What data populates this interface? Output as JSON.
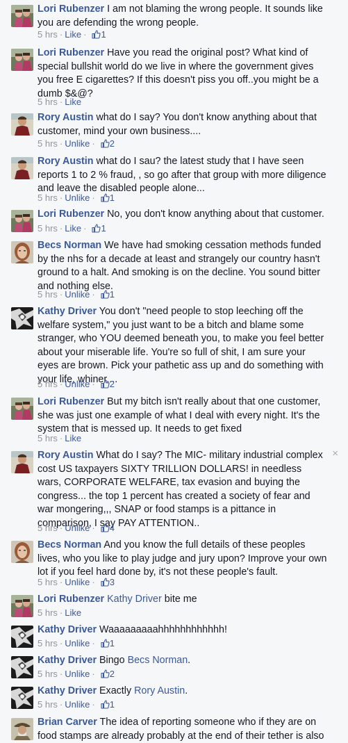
{
  "comments": [
    {
      "author": "Lori Rubenzer",
      "avatar": "lori-avatar",
      "segments": [
        {
          "text": "I am not blaming the wrong people. It sounds like you are defending the wrong people."
        }
      ],
      "time": "5 hrs",
      "action": "Like",
      "likes": "1"
    },
    {
      "author": "Lori Rubenzer",
      "avatar": "lori-avatar",
      "segments": [
        {
          "text": "Have you read the original post? What kind of special bullshit world do we live in where the government gives you free E cigarettes? If this doesn't piss you off..you might be a dumb $&@?"
        }
      ],
      "time": "5 hrs",
      "action": "Like",
      "likes": ""
    },
    {
      "author": "Rory Austin",
      "avatar": "rory-avatar",
      "segments": [
        {
          "text": "what do I say? You don't know anything about that customer, mind your own business...."
        }
      ],
      "time": "5 hrs",
      "action": "Unlike",
      "likes": "2"
    },
    {
      "author": "Rory Austin",
      "avatar": "rory-avatar",
      "segments": [
        {
          "text": "what do I sau? the latest study that I have seen reports 1 to 2 % fraud, , so go after that group with more diligence and leave the disabled people alone..."
        }
      ],
      "time": "5 hrs",
      "action": "Unlike",
      "likes": "1"
    },
    {
      "author": "Lori Rubenzer",
      "avatar": "lori-avatar",
      "segments": [
        {
          "text": "No, you don't know anything about that customer."
        }
      ],
      "time": "5 hrs",
      "action": "Like",
      "likes": "1"
    },
    {
      "author": "Becs Norman",
      "avatar": "becs-avatar",
      "segments": [
        {
          "text": "We have had smoking cessation methods funded by the nhs for a decade at least and strangely our country hasn't ground to a halt. And smoking is on the decline. You sound bitter and nothing else."
        }
      ],
      "time": "5 hrs",
      "action": "Unlike",
      "likes": "1"
    },
    {
      "author": "Kathy Driver",
      "avatar": "kathy-avatar",
      "segments": [
        {
          "text": "You don't \"need people to stop leeching off the welfare system,\" you just want to be a bitch and blame some stranger, who YOU deemed beneath you, to make you feel better about your miserable life. You're so full of shit, I am sure your eyes are brown. Pick your pathetic ass up and do something with your life, whiner...."
        }
      ],
      "time": "5 hrs",
      "action": "Unlike",
      "likes": "2"
    },
    {
      "author": "Lori Rubenzer",
      "avatar": "lori-avatar",
      "segments": [
        {
          "text": "But my bitch isn't really about that one customer, she was just one example of what I deal with every night. It's the system that is messed up. It needs to get fixed"
        }
      ],
      "time": "5 hrs",
      "action": "Like",
      "likes": ""
    },
    {
      "author": "Rory Austin",
      "avatar": "rory-avatar",
      "segments": [
        {
          "text": "What do I say? The MIC- military industrial complex cost US taxpayers SIXTY TRILLION DOLLARS! in needless wars, CORPORATE WELFARE, tax evasion and buying the congress... the top 1 percent has created a society of fear and war mongering,,, SNAP or food stamps is a pittance in comparison, I say PAY ATTENTION.."
        }
      ],
      "time": "5 hrs",
      "action": "Unlike",
      "likes": "4",
      "close": "×"
    },
    {
      "author": "Becs Norman",
      "avatar": "becs-avatar",
      "segments": [
        {
          "text": "And you know the full details of these peoples lives, who you like to play judge and jury upon? Improve your own lot if you feel hard done by, it's not these people's fault."
        }
      ],
      "time": "5 hrs",
      "action": "Unlike",
      "likes": "3"
    },
    {
      "author": "Lori Rubenzer",
      "avatar": "lori-avatar",
      "segments": [
        {
          "text": "Kathy Driver",
          "mention": true
        },
        {
          "text": " bite me"
        }
      ],
      "time": "5 hrs",
      "action": "Like",
      "likes": ""
    },
    {
      "author": "Kathy Driver",
      "avatar": "kathy-avatar",
      "segments": [
        {
          "text": "Waaaaaaaaahhhhhhhhhhhh!"
        }
      ],
      "time": "5 hrs",
      "action": "Unlike",
      "likes": "1"
    },
    {
      "author": "Kathy Driver",
      "avatar": "kathy-avatar",
      "segments": [
        {
          "text": "Bingo "
        },
        {
          "text": "Becs Norman",
          "mention": true
        },
        {
          "text": "."
        }
      ],
      "time": "5 hrs",
      "action": "Unlike",
      "likes": "2"
    },
    {
      "author": "Kathy Driver",
      "avatar": "kathy-avatar",
      "segments": [
        {
          "text": "Exactly "
        },
        {
          "text": "Rory Austin",
          "mention": true
        },
        {
          "text": "."
        }
      ],
      "time": "5 hrs",
      "action": "Unlike",
      "likes": "1"
    },
    {
      "author": "Brian Carver",
      "avatar": "brian-avatar",
      "segments": [
        {
          "text": "The idea of reporting someone who if they are on food stamps are already probably at the end of their tether is also"
        }
      ],
      "time": "",
      "action": "",
      "likes": ""
    }
  ],
  "colors": {
    "link": "#3b5998",
    "text": "#141823",
    "meta": "#90949c",
    "background": "#f6f7f9"
  }
}
